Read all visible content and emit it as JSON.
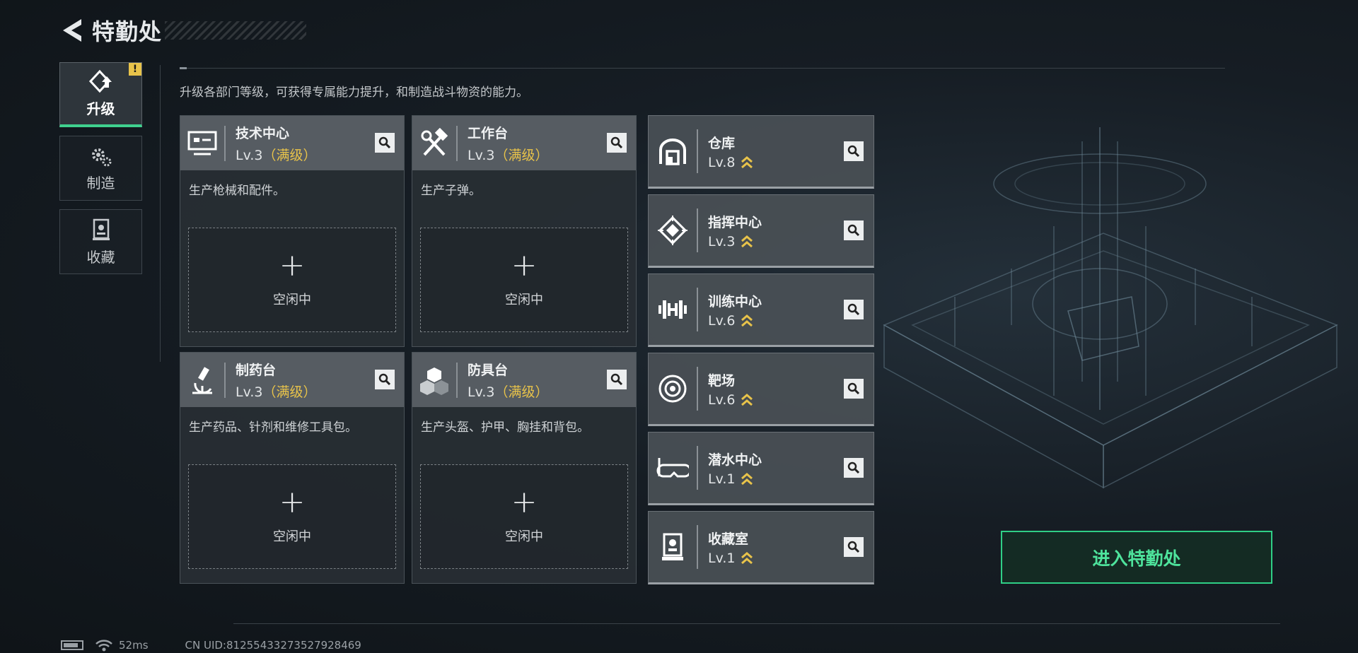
{
  "header": {
    "title": "特勤处"
  },
  "nav": [
    {
      "label": "升级",
      "active": true,
      "badge": "!"
    },
    {
      "label": "制造",
      "active": false
    },
    {
      "label": "收藏",
      "active": false
    }
  ],
  "hint": "升级各部门等级，可获得专属能力提升，和制造战斗物资的能力。",
  "big_cards": [
    {
      "name": "技术中心",
      "level": "Lv.3",
      "max": "（满级）",
      "desc": "生产枪械和配件。",
      "slot_plus": "+",
      "slot_label": "空闲中"
    },
    {
      "name": "工作台",
      "level": "Lv.3",
      "max": "（满级）",
      "desc": "生产子弹。",
      "slot_plus": "+",
      "slot_label": "空闲中"
    },
    {
      "name": "制药台",
      "level": "Lv.3",
      "max": "（满级）",
      "desc": "生产药品、针剂和维修工具包。",
      "slot_plus": "+",
      "slot_label": "空闲中"
    },
    {
      "name": "防具台",
      "level": "Lv.3",
      "max": "（满级）",
      "desc": "生产头盔、护甲、胸挂和背包。",
      "slot_plus": "+",
      "slot_label": "空闲中"
    }
  ],
  "small_cards": [
    {
      "name": "仓库",
      "level": "Lv.8",
      "icon": "warehouse-icon"
    },
    {
      "name": "指挥中心",
      "level": "Lv.3",
      "icon": "command-center-icon"
    },
    {
      "name": "训练中心",
      "level": "Lv.6",
      "icon": "dumbbell-icon"
    },
    {
      "name": "靶场",
      "level": "Lv.6",
      "icon": "target-icon"
    },
    {
      "name": "潜水中心",
      "level": "Lv.1",
      "icon": "diving-mask-icon"
    },
    {
      "name": "收藏室",
      "level": "Lv.1",
      "icon": "collection-icon"
    }
  ],
  "enter_button": "进入特勤处",
  "status": {
    "ping": "52ms",
    "uid": "CN UID:8125543327352792846­9"
  },
  "colors": {
    "accent_green": "#2fcf86",
    "gold": "#e8c34a"
  }
}
